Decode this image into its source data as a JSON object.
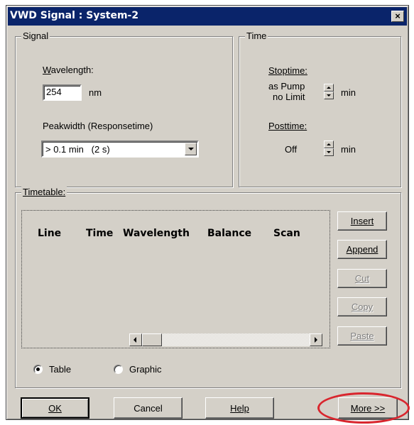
{
  "window": {
    "title": "VWD Signal : System-2",
    "close_glyph": "×"
  },
  "signal": {
    "legend": "Signal",
    "wavelength_label": "Wavelength:",
    "wavelength_value": "254",
    "wavelength_unit": "nm",
    "peakwidth_label": "Peakwidth (Responsetime)",
    "peakwidth_value": "> 0.1 min   (2 s)"
  },
  "time": {
    "legend": "Time",
    "stoptime_label": "Stoptime:",
    "stoptime_value_line1": "as Pump",
    "stoptime_value_line2": "no Limit",
    "stoptime_unit": "min",
    "posttime_label": "Posttime:",
    "posttime_value": "Off",
    "posttime_unit": "min"
  },
  "timetable": {
    "legend": "Timetable:",
    "columns": [
      "Line",
      "Time",
      "Wavelength",
      "Balance",
      "Scan"
    ],
    "buttons": {
      "insert": "Insert",
      "append": "Append",
      "cut": "Cut",
      "copy": "Copy",
      "paste": "Paste"
    },
    "view_options": {
      "table": "Table",
      "graphic": "Graphic",
      "selected": "Table"
    }
  },
  "footer": {
    "ok": "OK",
    "cancel": "Cancel",
    "help": "Help",
    "more": "More >>"
  },
  "colors": {
    "titlebar": "#0a246a",
    "dialog_bg": "#d4d0c8",
    "highlight_ellipse": "#d9262e"
  },
  "icons": [
    "close-icon",
    "spin-up-icon",
    "spin-down-icon",
    "dropdown-arrow-icon",
    "scroll-left-icon",
    "scroll-right-icon"
  ]
}
